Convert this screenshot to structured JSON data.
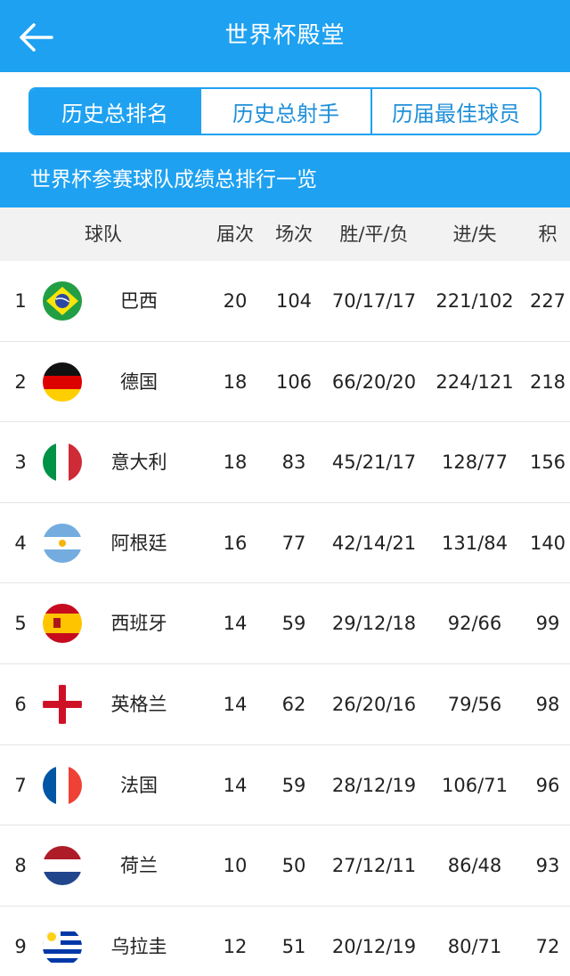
{
  "header": {
    "title": "世界杯殿堂",
    "back_icon": "arrow-left-icon"
  },
  "tabs": [
    {
      "label": "历史总排名",
      "active": true
    },
    {
      "label": "历史总射手",
      "active": false
    },
    {
      "label": "历届最佳球员",
      "active": false
    }
  ],
  "section_title": "世界杯参赛球队成绩总排行一览",
  "table": {
    "headers": {
      "team": "球队",
      "appearances": "届次",
      "matches": "场次",
      "wdl": "胜/平/负",
      "goals": "进/失",
      "points": "积"
    },
    "rows": [
      {
        "rank": "1",
        "flag": "brazil-flag-icon",
        "team": "巴西",
        "appearances": "20",
        "matches": "104",
        "wdl": "70/17/17",
        "goals": "221/102",
        "points": "227"
      },
      {
        "rank": "2",
        "flag": "germany-flag-icon",
        "team": "德国",
        "appearances": "18",
        "matches": "106",
        "wdl": "66/20/20",
        "goals": "224/121",
        "points": "218"
      },
      {
        "rank": "3",
        "flag": "italy-flag-icon",
        "team": "意大利",
        "appearances": "18",
        "matches": "83",
        "wdl": "45/21/17",
        "goals": "128/77",
        "points": "156"
      },
      {
        "rank": "4",
        "flag": "argentina-flag-icon",
        "team": "阿根廷",
        "appearances": "16",
        "matches": "77",
        "wdl": "42/14/21",
        "goals": "131/84",
        "points": "140"
      },
      {
        "rank": "5",
        "flag": "spain-flag-icon",
        "team": "西班牙",
        "appearances": "14",
        "matches": "59",
        "wdl": "29/12/18",
        "goals": "92/66",
        "points": "99"
      },
      {
        "rank": "6",
        "flag": "england-flag-icon",
        "team": "英格兰",
        "appearances": "14",
        "matches": "62",
        "wdl": "26/20/16",
        "goals": "79/56",
        "points": "98"
      },
      {
        "rank": "7",
        "flag": "france-flag-icon",
        "team": "法国",
        "appearances": "14",
        "matches": "59",
        "wdl": "28/12/19",
        "goals": "106/71",
        "points": "96"
      },
      {
        "rank": "8",
        "flag": "netherlands-flag-icon",
        "team": "荷兰",
        "appearances": "10",
        "matches": "50",
        "wdl": "27/12/11",
        "goals": "86/48",
        "points": "93"
      },
      {
        "rank": "9",
        "flag": "uruguay-flag-icon",
        "team": "乌拉圭",
        "appearances": "12",
        "matches": "51",
        "wdl": "20/12/19",
        "goals": "80/71",
        "points": "72"
      }
    ]
  },
  "colors": {
    "accent": "#1ea1f1",
    "header_bg": "#f2f2f2",
    "divider": "#e4e4e4"
  }
}
